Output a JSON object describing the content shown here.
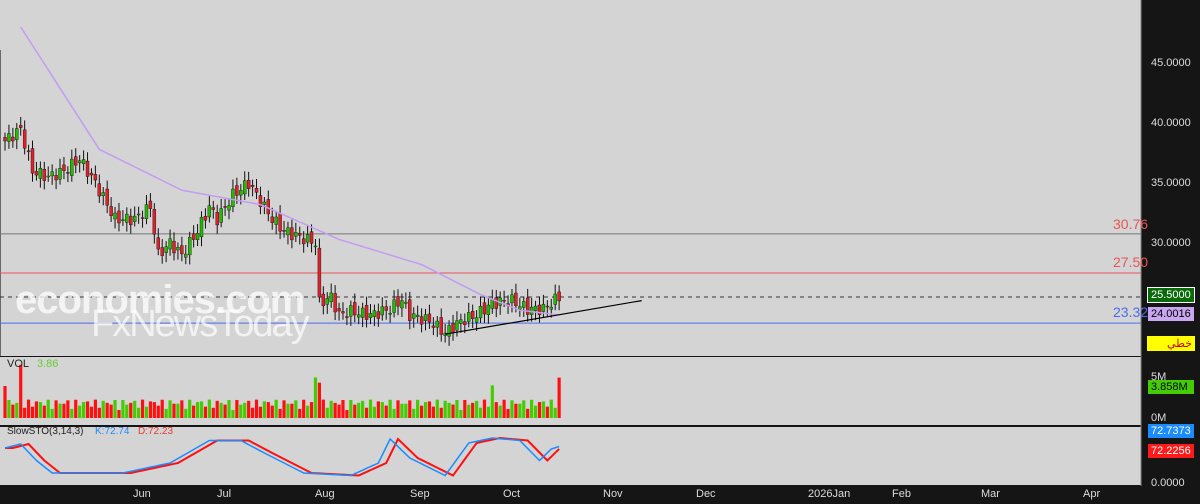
{
  "chart_data": {
    "type": "candlestick",
    "price_axis": {
      "ticks": [
        "45.0000",
        "40.0000",
        "35.0000",
        "30.0000"
      ],
      "range": [
        20.5,
        50.3
      ]
    },
    "time_axis": [
      "Jun",
      "Jul",
      "Aug",
      "Sep",
      "Oct",
      "Nov",
      "Dec",
      "2026Jan",
      "Feb",
      "Mar",
      "Apr"
    ],
    "close_keypoints": [
      [
        0,
        38.5
      ],
      [
        4,
        39.5
      ],
      [
        7,
        36
      ],
      [
        11,
        35.5
      ],
      [
        15,
        36
      ],
      [
        19,
        37
      ],
      [
        23,
        35
      ],
      [
        28,
        32
      ],
      [
        33,
        32
      ],
      [
        37,
        33
      ],
      [
        39,
        29
      ],
      [
        42,
        30
      ],
      [
        45,
        29
      ],
      [
        49,
        31
      ],
      [
        52,
        33
      ],
      [
        54,
        32
      ],
      [
        58,
        34
      ],
      [
        62,
        35
      ],
      [
        66,
        33
      ],
      [
        68,
        32
      ],
      [
        71,
        31
      ],
      [
        75,
        30.5
      ],
      [
        79,
        30
      ],
      [
        80,
        25
      ],
      [
        83,
        25.5
      ],
      [
        85,
        24
      ],
      [
        88,
        24.3
      ],
      [
        93,
        24
      ],
      [
        98,
        24.5
      ],
      [
        101,
        25.3
      ],
      [
        103,
        24
      ],
      [
        108,
        23.5
      ],
      [
        112,
        22.5
      ],
      [
        116,
        23.5
      ],
      [
        120,
        24
      ],
      [
        124,
        25
      ],
      [
        129,
        25.2
      ],
      [
        133,
        24.5
      ],
      [
        137,
        24.5
      ],
      [
        141,
        25.5
      ]
    ],
    "moving_average_keypoints": [
      [
        4,
        48
      ],
      [
        24,
        37.8
      ],
      [
        45,
        34.4
      ],
      [
        65,
        33.2
      ],
      [
        85,
        30.3
      ],
      [
        106,
        28.2
      ],
      [
        121,
        25.7
      ],
      [
        131,
        24.4
      ],
      [
        141,
        24.0
      ]
    ],
    "levels": [
      {
        "value": "30.76",
        "color": "#e8555a"
      },
      {
        "value": "27.50",
        "color": "#e8555a"
      },
      {
        "value": "23.32",
        "color": "#4a6cf0"
      }
    ],
    "trendline": [
      [
        112,
        22.4
      ],
      [
        162,
        25.2
      ]
    ],
    "last_price": "25.5000",
    "ma_value": "24.0016",
    "line_type_badge": "خطي",
    "volume": {
      "title": "VOL",
      "value": "3.86",
      "last": "3.858M",
      "ticks": [
        "5M",
        "0M"
      ]
    },
    "stochastic": {
      "title": "SlowSTO(3,14,3)",
      "k_label": "K:72.74",
      "d_label": "D:72.23",
      "k_last": "72.7373",
      "d_last": "72.2256",
      "tick": "0.0000",
      "k_keypoints": [
        [
          0,
          70
        ],
        [
          4,
          78
        ],
        [
          8,
          45
        ],
        [
          12,
          20
        ],
        [
          30,
          20
        ],
        [
          42,
          40
        ],
        [
          52,
          85
        ],
        [
          60,
          85
        ],
        [
          66,
          60
        ],
        [
          76,
          20
        ],
        [
          88,
          15
        ],
        [
          95,
          40
        ],
        [
          98,
          88
        ],
        [
          103,
          50
        ],
        [
          112,
          15
        ],
        [
          118,
          80
        ],
        [
          124,
          90
        ],
        [
          131,
          85
        ],
        [
          136,
          45
        ],
        [
          139,
          68
        ],
        [
          141,
          73
        ]
      ]
    },
    "watermark": [
      "economies.com",
      "FxNewsToday"
    ]
  }
}
